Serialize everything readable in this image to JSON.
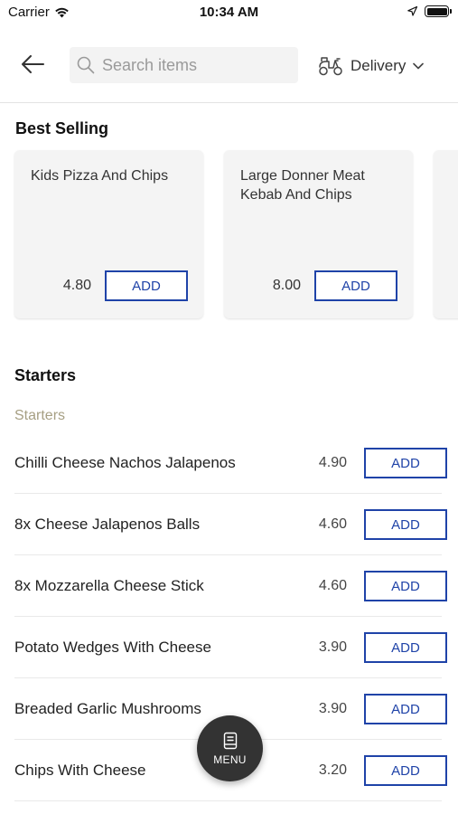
{
  "status_bar": {
    "carrier": "Carrier",
    "time": "10:34 AM"
  },
  "header": {
    "search_placeholder": "Search items",
    "delivery_label": "Delivery"
  },
  "best_selling": {
    "title": "Best Selling",
    "cards": [
      {
        "name": "Kids Pizza And Chips",
        "price": "4.80",
        "add_label": "ADD"
      },
      {
        "name": "Large Donner Meat Kebab And Chips",
        "price": "8.00",
        "add_label": "ADD"
      }
    ]
  },
  "starters": {
    "title": "Starters",
    "subcategory": "Starters",
    "items": [
      {
        "name": "Chilli Cheese Nachos Jalapenos",
        "price": "4.90",
        "add_label": "ADD"
      },
      {
        "name": "8x Cheese Jalapenos Balls",
        "price": "4.60",
        "add_label": "ADD"
      },
      {
        "name": "8x Mozzarella Cheese Stick",
        "price": "4.60",
        "add_label": "ADD"
      },
      {
        "name": "Potato Wedges With Cheese",
        "price": "3.90",
        "add_label": "ADD"
      },
      {
        "name": "Breaded Garlic Mushrooms",
        "price": "3.90",
        "add_label": "ADD"
      },
      {
        "name": "Chips With Cheese",
        "price": "3.20",
        "add_label": "ADD"
      }
    ]
  },
  "menu_button": {
    "label": "MENU"
  },
  "colors": {
    "accent": "#1f43a8",
    "subcategory": "#a69f83",
    "fab": "#333333"
  }
}
